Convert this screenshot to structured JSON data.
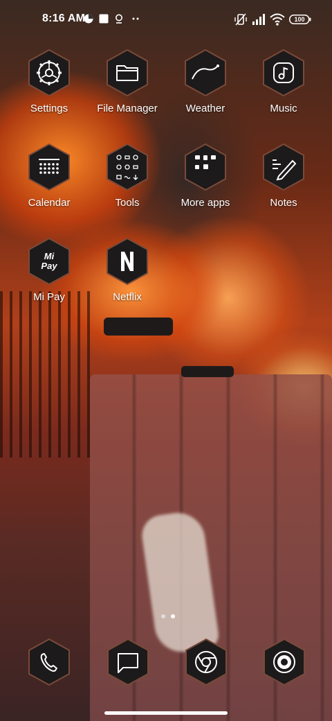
{
  "status_bar": {
    "time": "8:16 AM",
    "battery": "100",
    "left_icons": [
      "chart-icon",
      "square-notification-icon",
      "location-icon",
      "more-dots-icon"
    ],
    "right_icons": [
      "vibrate-off-icon",
      "signal-icon",
      "wifi-icon",
      "battery-icon"
    ]
  },
  "apps": [
    {
      "label": "Settings",
      "icon": "gear-icon"
    },
    {
      "label": "File Manager",
      "icon": "folder-icon"
    },
    {
      "label": "Weather",
      "icon": "weather-curve-icon"
    },
    {
      "label": "Music",
      "icon": "music-note-icon"
    },
    {
      "label": "Calendar",
      "icon": "calendar-grid-icon"
    },
    {
      "label": "Tools",
      "icon": "tools-folder-icon"
    },
    {
      "label": "More apps",
      "icon": "apps-folder-icon"
    },
    {
      "label": "Notes",
      "icon": "pencil-icon"
    },
    {
      "label": "Mi Pay",
      "icon": "mi-pay-logo"
    },
    {
      "label": "Netflix",
      "icon": "netflix-logo"
    }
  ],
  "mi_pay_logo_text": "Mi Pay",
  "page_indicator": {
    "pages": 2,
    "current": 2
  },
  "dock": [
    {
      "name": "phone",
      "icon": "phone-icon"
    },
    {
      "name": "messages",
      "icon": "message-icon"
    },
    {
      "name": "chrome",
      "icon": "chrome-icon"
    },
    {
      "name": "camera",
      "icon": "camera-icon"
    }
  ],
  "colors": {
    "hex_fill": "#1c1a1a",
    "hex_border": "#7a4a3a",
    "icon": "#ffffff"
  }
}
